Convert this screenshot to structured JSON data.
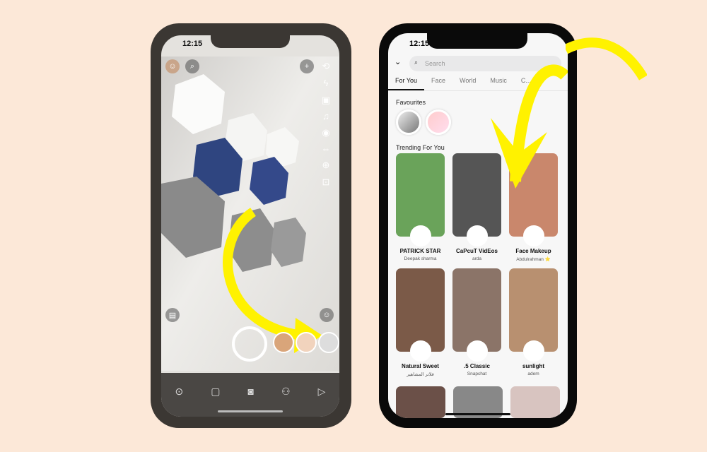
{
  "camera": {
    "time": "12:15",
    "icons": [
      "avatar",
      "search-icon",
      "add-friend-icon",
      "flip-camera-icon",
      "flash-off-icon",
      "video-icon",
      "music-icon",
      "camera-mode-icon",
      "dual-camera-icon",
      "plus-icon",
      "scan-icon",
      "memories-icon",
      "lens-explore-icon"
    ],
    "nav": [
      "map-icon",
      "chat-icon",
      "camera-icon",
      "friends-icon",
      "stories-icon"
    ]
  },
  "lenses": {
    "time": "12:15",
    "search_placeholder": "Search",
    "tabs": [
      "For You",
      "Face",
      "World",
      "Music",
      "C..."
    ],
    "favourites_label": "Favourites",
    "trending_label": "Trending For You",
    "cards": [
      {
        "name": "PATRICK STAR",
        "author": "Deepak sharma",
        "color": "#6aa35a"
      },
      {
        "name": "CaPcuT VidEos",
        "author": "arda",
        "color": "#555"
      },
      {
        "name": "Face Makeup",
        "author": "Abdulrahman ⭐",
        "color": "#c9876c"
      },
      {
        "name": "Natural Sweet",
        "author": "فلاتر المشاهير",
        "color": "#7b5a48"
      },
      {
        "name": ".5 Classic",
        "author": "Snapchat",
        "color": "#8b7468"
      },
      {
        "name": "sunlight",
        "author": "adem",
        "color": "#b89070"
      }
    ]
  },
  "accent": "#fff200"
}
